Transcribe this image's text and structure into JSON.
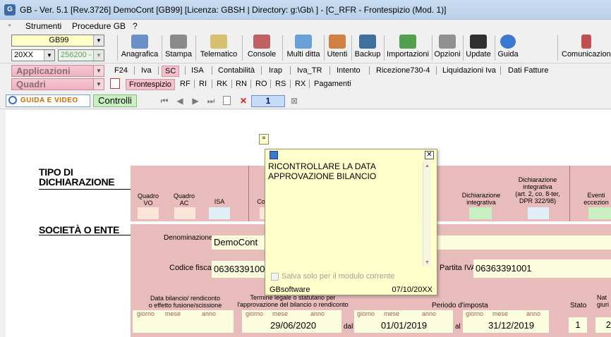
{
  "window": {
    "title": "GB - Ver. 5.1 [Rev.3726]  DemoCont [GB99]  [Licenza: GBSH | Directory: g:\\Gb\\ ] - [C_RFR - Frontespizio (Mod. 1)]",
    "icon": "gb-logo-icon"
  },
  "menu": [
    "Strumenti",
    "Procedure GB",
    "?"
  ],
  "toolbar": {
    "company": "GB99",
    "year": "20XX",
    "code": "256200 -",
    "buttons": [
      {
        "label": "Anagrafica",
        "icon": "anagrafica-icon",
        "color": "#6b8fc9"
      },
      {
        "label": "Stampa",
        "icon": "printer-icon",
        "color": "#8a8a8a"
      },
      {
        "label": "Telematico",
        "icon": "telematico-icon",
        "color": "#d8c070"
      },
      {
        "label": "Console",
        "icon": "console-icon",
        "color": "#c06060"
      },
      {
        "label": "Multi ditta",
        "icon": "multi-ditta-icon",
        "color": "#6aa0d8"
      },
      {
        "label": "Utenti",
        "icon": "users-icon",
        "color": "#d08040"
      },
      {
        "label": "Backup",
        "icon": "backup-icon",
        "color": "#4070a0"
      },
      {
        "label": "Importazioni",
        "icon": "import-icon",
        "color": "#50a050"
      },
      {
        "label": "Opzioni",
        "icon": "wrench-icon",
        "color": "#909090"
      },
      {
        "label": "Update",
        "icon": "update-icon",
        "color": "#303030"
      },
      {
        "label": "Guida",
        "icon": "help-icon",
        "color": "#3a7ad0"
      },
      {
        "label": "Comunicazioni",
        "icon": "comunicazioni-icon",
        "color": "#c05050"
      }
    ]
  },
  "applicazioni": {
    "label": "Applicazioni",
    "tabs": [
      "F24",
      "Iva",
      "SC",
      "ISA",
      "Contabilità",
      "Irap",
      "Iva_TR",
      "Intento",
      "Ricezione730-4",
      "Liquidazioni Iva",
      "Dati Fatture"
    ],
    "active": "SC"
  },
  "quadri": {
    "label": "Quadri",
    "tabs": [
      "Frontespizio",
      "RF",
      "RI",
      "RK",
      "RN",
      "RO",
      "RS",
      "RX",
      "Pagamenti"
    ],
    "active": "Frontespizio"
  },
  "nav": {
    "guida": "GUIDA E VIDEO",
    "controlli": "Controlli",
    "page": "1"
  },
  "form": {
    "tipo_title": "TIPO DI\nDICHIARAZIONE",
    "quadro_vo": "Quadro\nVO",
    "quadro_ac": "Quadro\nAC",
    "isa": "ISA",
    "co": "Co",
    "dich_integrativa": "Dichiarazione\nintegrativa",
    "dich_integrativa_art": "Dichiarazione\nintegrativa\n(art. 2, co. 8-ter,\nDPR 322/98)",
    "eventi": "Eventi\neccezion",
    "societa_title": "SOCIETÀ O ENTE",
    "denominazione_label": "Denominazione",
    "denominazione": "DemoCont",
    "cf_label": "Codice fiscale",
    "cf": "0636339100",
    "piva_label": "Partita IVA",
    "piva": "06363391001",
    "data_bilancio": "Data bilancio/ rendiconto\no effetto fusione/scissione",
    "termine": "Termine legale o statutario per\nl'approvazione del bilancio o rendiconto",
    "periodo": "Periodo d'imposta",
    "stato": "Stato",
    "nat": "Nat\ngiuri",
    "giorno": "giorno",
    "mese": "mese",
    "anno": "anno",
    "termine_val": "29/06/2020",
    "dal": "dal",
    "dal_val": "01/01/2019",
    "al": "al",
    "al_val": "31/12/2019",
    "stato_val": "1",
    "nat_val": "2"
  },
  "popup": {
    "line1": "RICONTROLLARE LA DATA",
    "line2": "APPROVAZIONE BILANCIO",
    "checkbox": "Salva solo per il modulo corrente",
    "author": "GBsoftware",
    "date": "07/10/20XX"
  }
}
